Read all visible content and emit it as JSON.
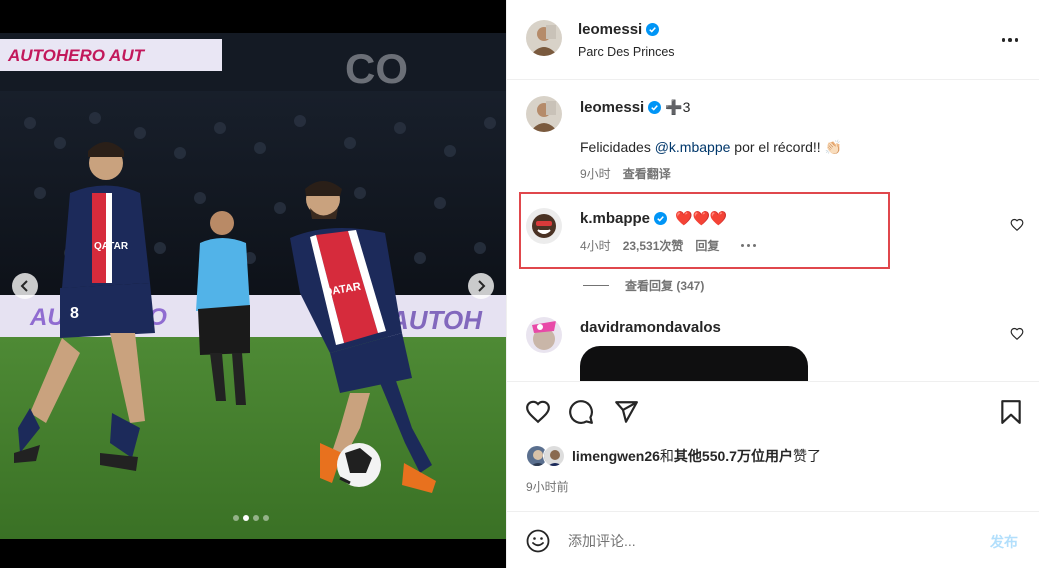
{
  "post": {
    "author": "leomessi",
    "location": "Parc Des Princes"
  },
  "comments": [
    {
      "username": "leomessi",
      "extra_emoji": "➕3",
      "text_prefix": "Felicidades ",
      "mention": "@k.mbappe",
      "text_suffix": " por el récord!! 👏🏻",
      "time": "9小时",
      "translate": "查看翻译"
    },
    {
      "username": "k.mbappe",
      "emoji": "❤️❤️❤️",
      "time": "4小时",
      "likes": "23,531次赞",
      "reply": "回复",
      "view_replies": "查看回复 (347)"
    },
    {
      "username": "davidramondavalos"
    }
  ],
  "likes_summary": {
    "user": "limengwen26",
    "connector": "和",
    "others": "其他550.7万位用户",
    "suffix": "赞了"
  },
  "posted_time": "9小时前",
  "composer": {
    "placeholder": "添加评论...",
    "post_label": "发布"
  },
  "carousel": {
    "slide_count": 4,
    "active_slide": 2
  },
  "colors": {
    "verified": "#0095f6",
    "highlight": "#e0474c",
    "post_disabled": "#b2dffc"
  }
}
